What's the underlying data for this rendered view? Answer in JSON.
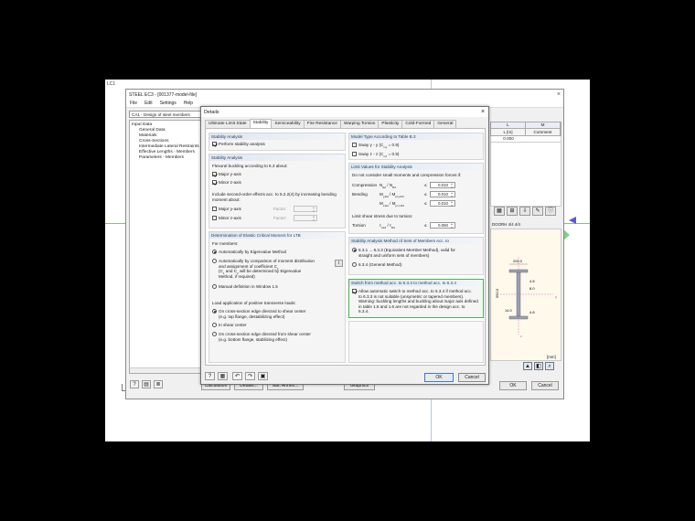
{
  "canvas": {
    "lc_label": "LC1"
  },
  "module": {
    "title": "STEEL EC3 - [001377-model-file]",
    "menu": [
      "File",
      "Edit",
      "Settings",
      "Help"
    ],
    "case_combo": "CA1 - Design of steel members",
    "tree": [
      {
        "label": "Input Data",
        "sub": false
      },
      {
        "label": "General Data",
        "sub": true
      },
      {
        "label": "Materials",
        "sub": true
      },
      {
        "label": "Cross-Sections",
        "sub": true
      },
      {
        "label": "Intermediate Lateral Restraints",
        "sub": true
      },
      {
        "label": "Effective Lengths - Members",
        "sub": true
      },
      {
        "label": "Parameters - Members",
        "sub": true
      }
    ],
    "table_cols": [
      "L",
      "M"
    ],
    "table_sub": [
      "L [m]",
      "Comment"
    ],
    "table_row": [
      "0.000",
      ""
    ],
    "section_label": "DOORH 4/4 4/4",
    "unit": "[mm]",
    "dims": [
      "200.0",
      "4.8",
      "8.0",
      "14.0",
      "4.8",
      "550.0"
    ],
    "buttons": {
      "calculation": "Calculation",
      "details": "Details...",
      "nat_annex": "Nat. Annex...",
      "graphics": "Graphics",
      "ok": "OK",
      "cancel": "Cancel"
    }
  },
  "dialog": {
    "title": "Details",
    "tabs": [
      "Ultimate Limit State",
      "Stability",
      "Serviceability",
      "Fire Resistance",
      "Warping Torsion",
      "Plasticity",
      "Cold-Formed",
      "General"
    ],
    "active_tab": "Stability",
    "stability_analysis_1": {
      "header": "Stability Analysis",
      "perform": "Perform stability analysis"
    },
    "stability_analysis_2": {
      "header": "Stability Analysis",
      "flexural": "Flexural buckling according to 6.3 about:",
      "major": "Major y-axis",
      "minor": "Minor z-axis",
      "second_order_1": "Include second-order effects acc. to 5.2.2(4) by increasing bending",
      "second_order_2": "moment about:",
      "major2": "Major y-axis",
      "minor2": "Minor z-axis",
      "factor_label": "Factor:",
      "factor_val1": "",
      "factor_val2": ""
    },
    "mcr": {
      "header": "Determination of Elastic Critical Moment for LTB",
      "for_members": "For members:",
      "opt1": "Automatically by Eigenvalue Method",
      "opt2_l1": "Automatically by comparison of moment distribution",
      "opt2_l2": "and assignment of coefficient C",
      "opt2_l3": "(C",
      "opt2_l3b": " and C",
      "opt2_l3c": " will be determined by Eigenvalue",
      "opt2_l4": "Method, if required)",
      "opt3": "Manual definition in Window 1.5",
      "load_app": "Load application of positive transverse loads:",
      "la1_l1": "On cross-section edge directed to shear center",
      "la1_l2": "(e.g. top flange, destabilizing effect)",
      "la2": "In shear center",
      "la3_l1": "On cross-section edge directed from shear center",
      "la3_l2": "(e.g. bottom flange, stabilizing effect)"
    },
    "model_type": {
      "header": "Model Type According to Table B.3",
      "sway_y": "Sway y - y (C",
      "sway_y_b": " = 0.9)",
      "sway_z": "Sway z - z (C",
      "sway_z_b": " = 0.9)"
    },
    "limits": {
      "header": "Limit Values for Stability Analysis",
      "intro": "Do not consider small moments and compression forces if:",
      "compression": "Compression",
      "compression_f": "N",
      "compression_f2": " / N",
      "bending": "Bending",
      "bending_f": "M",
      "bending_f2": " / M",
      "compression_val": "0.010",
      "bending_val1": "0.010",
      "bending_val2": "0.010",
      "torsion_intro": "Limit shear stress due to torsion:",
      "torsion": "Torsion",
      "torsion_f": "τ",
      "torsion_f2": " / τ",
      "torsion_val": "0.050",
      "le": "≤"
    },
    "method": {
      "header": "Stability Analysis Method of Sets of Members Acc. to",
      "opt1_l1": "6.3.1 ... 6.3.3 (Equivalent Member Method), valid for",
      "opt1_l2": "straight and uniform sets of members)",
      "opt2": "6.3.4 (General Method)"
    },
    "switch": {
      "header": "Switch from method acc. to 6.3.3 to method acc. to 6.3.4",
      "l1": "Allow automatic switch to method acc. to 6.3.4 if method acc.",
      "l2": "to 6.3.3 is not suitable (unsymetric or tapered members).",
      "l3": "Warning: buckling lengths and buckling about major axis defined",
      "l4": "in table 1.5 and 1.6 are not regarded in the design acc. to",
      "l5": "6.3.4."
    },
    "ok": "OK",
    "cancel": "Cancel"
  },
  "colors": {
    "highlight_green": "#4caf50",
    "group_header": "#1f3f66"
  }
}
